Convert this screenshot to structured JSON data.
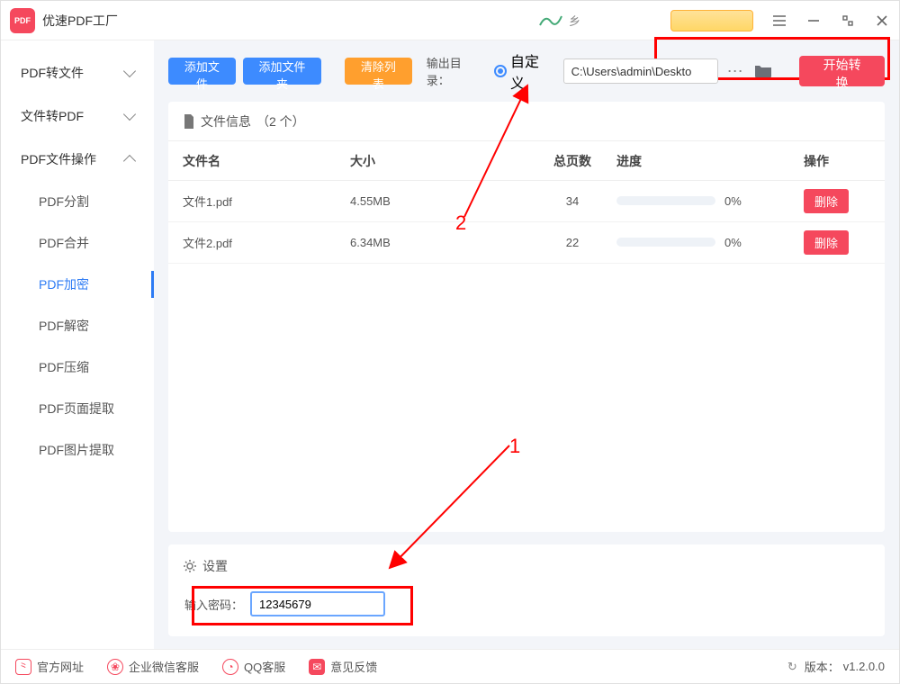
{
  "titlebar": {
    "app_name": "优速PDF工厂"
  },
  "sidebar": {
    "groups": [
      {
        "label": "PDF转文件",
        "expanded": false
      },
      {
        "label": "文件转PDF",
        "expanded": false
      },
      {
        "label": "PDF文件操作",
        "expanded": true
      }
    ],
    "items": [
      {
        "label": "PDF分割"
      },
      {
        "label": "PDF合并"
      },
      {
        "label": "PDF加密"
      },
      {
        "label": "PDF解密"
      },
      {
        "label": "PDF压缩"
      },
      {
        "label": "PDF页面提取"
      },
      {
        "label": "PDF图片提取"
      }
    ],
    "active_index": 2
  },
  "toolbar": {
    "add_file": "添加文件",
    "add_folder": "添加文件夹",
    "clear_list": "清除列表",
    "output_label": "输出目录：",
    "custom_label": "自定义",
    "output_path": "C:\\Users\\admin\\Deskto",
    "start_convert": "开始转换"
  },
  "file_panel": {
    "title_prefix": "文件信息",
    "title_count": "（2 个）",
    "headers": {
      "name": "文件名",
      "size": "大小",
      "pages": "总页数",
      "progress": "进度",
      "action": "操作"
    },
    "rows": [
      {
        "name": "文件1.pdf",
        "size": "4.55MB",
        "pages": "34",
        "progress": "0%",
        "action": "删除"
      },
      {
        "name": "文件2.pdf",
        "size": "6.34MB",
        "pages": "22",
        "progress": "0%",
        "action": "删除"
      }
    ]
  },
  "settings": {
    "title": "设置",
    "password_label": "输入密码：",
    "password_value": "12345679"
  },
  "footer": {
    "links": [
      {
        "label": "官方网址",
        "color": "#f5485d"
      },
      {
        "label": "企业微信客服",
        "color": "#f5485d"
      },
      {
        "label": "QQ客服",
        "color": "#f5485d"
      },
      {
        "label": "意见反馈",
        "color": "#f5485d"
      }
    ],
    "version_label": "版本：",
    "version_value": "v1.2.0.0"
  },
  "annotations": {
    "num1": "1",
    "num2": "2"
  }
}
